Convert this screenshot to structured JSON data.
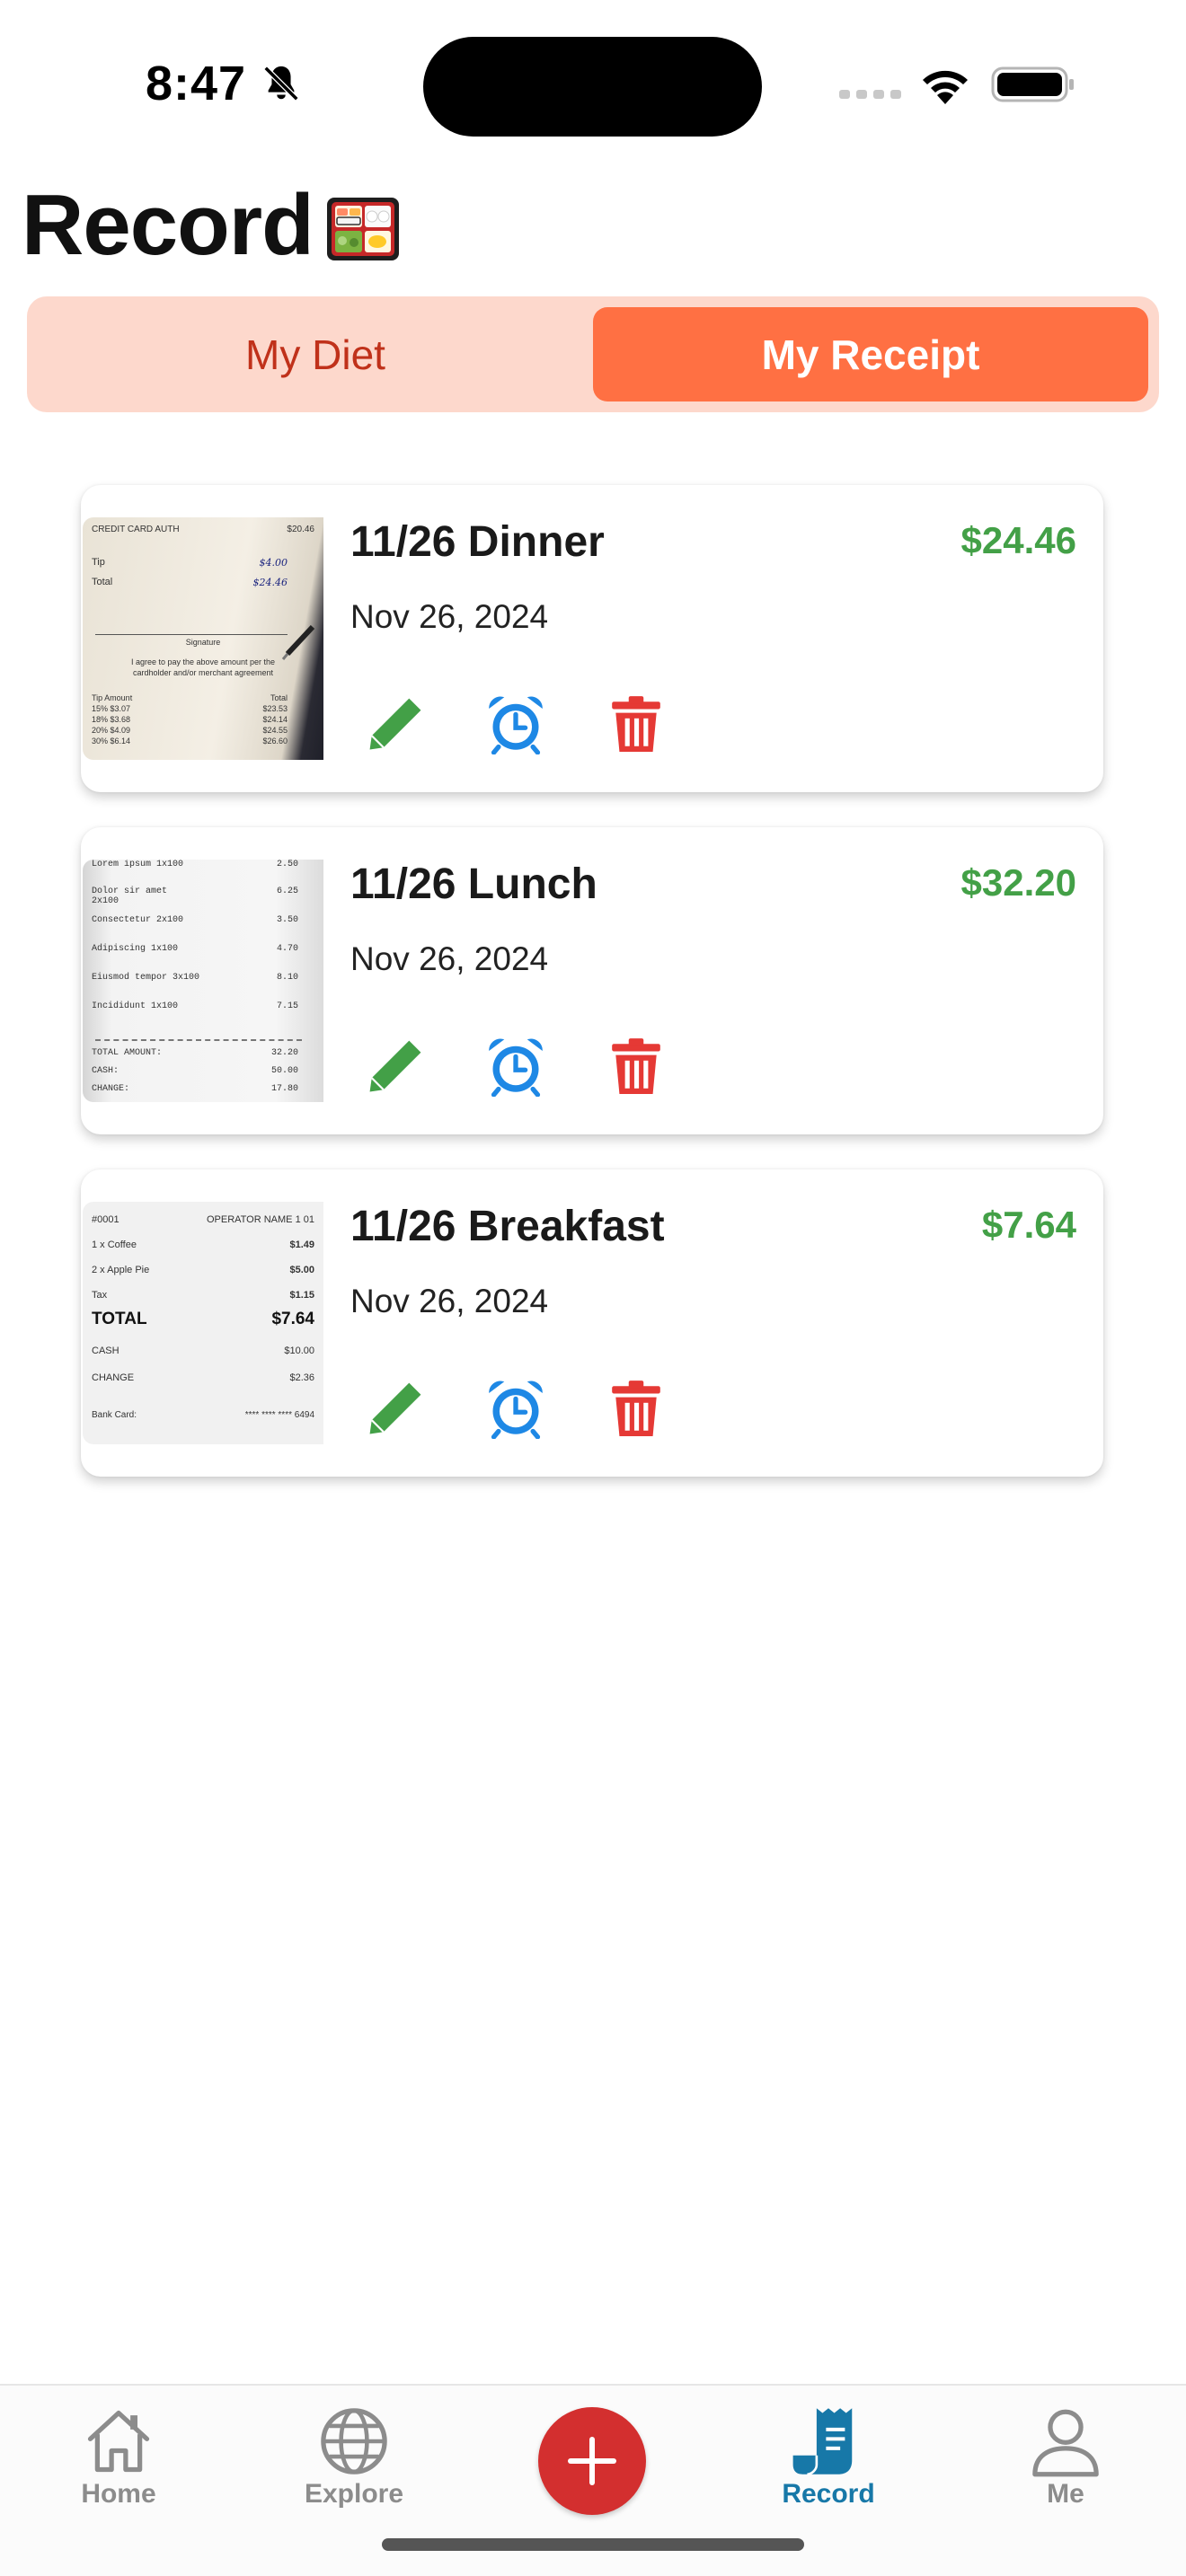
{
  "status_bar": {
    "time": "8:47"
  },
  "header": {
    "title": "Record"
  },
  "segmented": {
    "tabs": [
      "My Diet",
      "My Receipt"
    ],
    "selected": "My Receipt"
  },
  "receipts": [
    {
      "title": "11/26 Dinner",
      "amount": "$24.46",
      "date": "Nov 26, 2024",
      "thumb_lines": [
        [
          "CREDIT CARD AUTH",
          "$20.46"
        ],
        [
          "Tip",
          "$4.00"
        ],
        [
          "Total",
          "$24.46"
        ],
        [
          "Signature",
          ""
        ],
        [
          "I agree to pay the above amount per the",
          ""
        ],
        [
          "cardholder and/or merchant agreement",
          ""
        ],
        [
          "Tip   Amount",
          "Total"
        ],
        [
          "15%   $3.07",
          "$23.53"
        ],
        [
          "18%   $3.68",
          "$24.14"
        ],
        [
          "20%   $4.09",
          "$24.55"
        ],
        [
          "30%   $6.14",
          "$26.60"
        ]
      ]
    },
    {
      "title": "11/26 Lunch",
      "amount": "$32.20",
      "date": "Nov 26, 2024",
      "thumb_lines": [
        [
          "Lorem ipsum 1x100",
          "2.50"
        ],
        [
          "Dolor sir amet 2x100",
          "6.25"
        ],
        [
          "Consectetur 2x100",
          "3.50"
        ],
        [
          "Adipiscing 1x100",
          "4.70"
        ],
        [
          "Eiusmod tempor 3x100",
          "8.10"
        ],
        [
          "Incididunt 1x100",
          "7.15"
        ],
        [
          "TOTAL AMOUNT:",
          "32.20"
        ],
        [
          "CASH:",
          "50.00"
        ],
        [
          "CHANGE:",
          "17.80"
        ]
      ]
    },
    {
      "title": "11/26 Breakfast",
      "amount": "$7.64",
      "date": "Nov 26, 2024",
      "thumb_lines": [
        [
          "#0001",
          "OPERATOR NAME 1 01"
        ],
        [
          "1 x Coffee",
          "$1.49"
        ],
        [
          "2 x Apple Pie",
          "$5.00"
        ],
        [
          "Tax",
          "$1.15"
        ],
        [
          "TOTAL",
          "$7.64"
        ],
        [
          "CASH",
          "$10.00"
        ],
        [
          "CHANGE",
          "$2.36"
        ],
        [
          "Bank Card:",
          "**** **** **** 6494"
        ]
      ]
    }
  ],
  "actions": {
    "edit_icon": "pencil-icon",
    "alarm_icon": "alarm-clock-icon",
    "delete_icon": "trash-icon"
  },
  "bottom_nav": {
    "items": [
      {
        "label": "Home",
        "icon": "house-icon"
      },
      {
        "label": "Explore",
        "icon": "globe-icon"
      },
      {
        "label": "",
        "icon": "plus-icon"
      },
      {
        "label": "Record",
        "icon": "receipt-icon"
      },
      {
        "label": "Me",
        "icon": "person-icon"
      }
    ],
    "active": "Record"
  },
  "colors": {
    "accent": "#ff7043",
    "segment_bg": "#fdd8cc",
    "amount_green": "#43a047",
    "edit_green": "#43a047",
    "alarm_blue": "#1e88e5",
    "delete_red": "#e53935",
    "fab_red": "#d32f2f",
    "nav_active": "#1778a8"
  }
}
